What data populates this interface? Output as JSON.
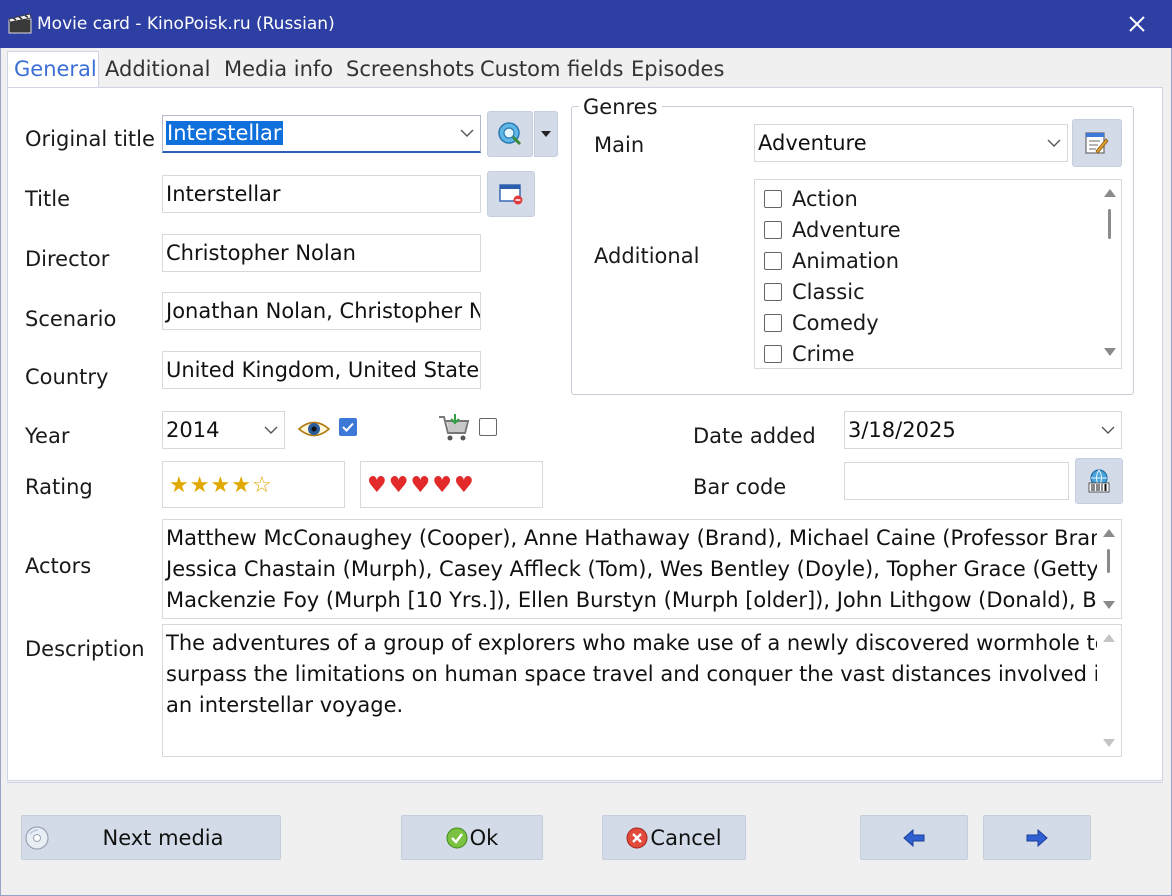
{
  "window": {
    "title": "Movie card - KinoPoisk.ru (Russian)"
  },
  "tabs": [
    "General",
    "Additional",
    "Media info",
    "Screenshots",
    "Custom fields",
    "Episodes"
  ],
  "form": {
    "original_title_label": "Original title",
    "original_title_value": "Interstellar",
    "title_label": "Title",
    "title_value": "Interstellar",
    "director_label": "Director",
    "director_value": "Christopher Nolan",
    "scenario_label": "Scenario",
    "scenario_value": "Jonathan Nolan, Christopher N",
    "country_label": "Country",
    "country_value": "United Kingdom, United States",
    "year_label": "Year",
    "year_value": "2014",
    "watched_checked": true,
    "wishlist_checked": false,
    "rating_label": "Rating",
    "stars_rating": 4,
    "stars_max": 5,
    "hearts_rating": 5,
    "hearts_max": 5,
    "date_added_label": "Date added",
    "date_added_value": "3/18/2025",
    "barcode_label": "Bar code",
    "barcode_value": "",
    "actors_label": "Actors",
    "actors_lines": [
      "Matthew McConaughey (Cooper), Anne Hathaway (Brand), Michael Caine (Professor Brand),",
      "Jessica Chastain (Murph), Casey Affleck (Tom), Wes Bentley (Doyle), Topher Grace (Getty),",
      "Mackenzie Foy (Murph [10 Yrs.]), Ellen Burstyn (Murph [older]), John Lithgow (Donald), Bill"
    ],
    "description_label": "Description",
    "description_lines": [
      "The adventures of a group of explorers who make use of a newly discovered wormhole to",
      "surpass the limitations on human space travel and conquer the vast distances involved in",
      "an interstellar voyage."
    ]
  },
  "genres": {
    "group_label": "Genres",
    "main_label": "Main",
    "main_value": "Adventure",
    "additional_label": "Additional",
    "items": [
      {
        "label": "Action",
        "checked": false
      },
      {
        "label": "Adventure",
        "checked": false
      },
      {
        "label": "Animation",
        "checked": false
      },
      {
        "label": "Classic",
        "checked": false
      },
      {
        "label": "Comedy",
        "checked": false
      },
      {
        "label": "Crime",
        "checked": false
      }
    ]
  },
  "buttons": {
    "next_media": "Next media",
    "ok": "Ok",
    "cancel": "Cancel"
  },
  "colors": {
    "titlebar": "#2e3fa3",
    "active_tab": "#3c6fd6",
    "button_bg": "#d3dbe8"
  }
}
